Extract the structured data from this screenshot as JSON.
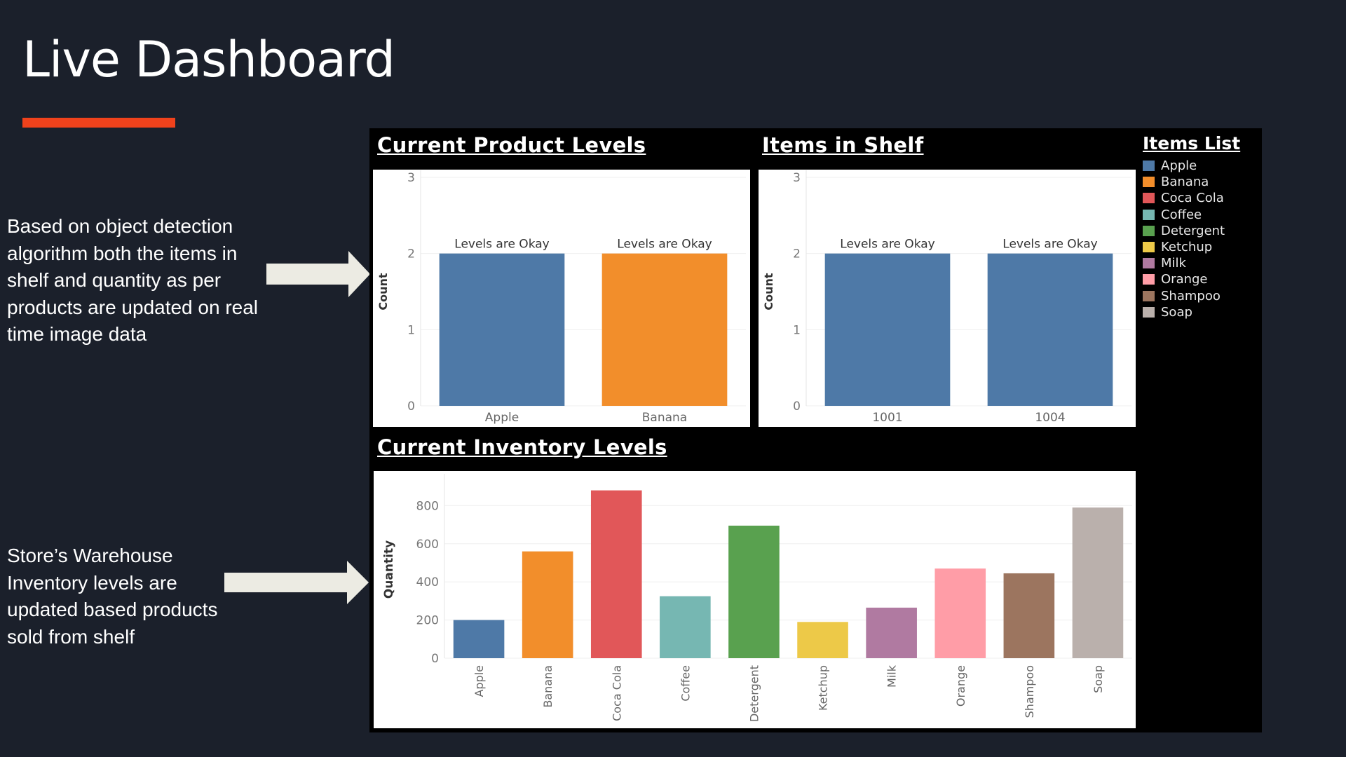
{
  "page": {
    "title": "Live Dashboard",
    "accent_color": "#f0421c",
    "background": "#1b202b"
  },
  "notes": [
    "Based on object detection algorithm both the items in shelf and quantity as per products are updated on real time image data",
    "Store’s Warehouse Inventory levels are updated based products sold from shelf"
  ],
  "legend": {
    "title": "Items List",
    "items": [
      {
        "label": "Apple",
        "color": "#4e79a7"
      },
      {
        "label": "Banana",
        "color": "#f28e2b"
      },
      {
        "label": "Coca Cola",
        "color": "#e15759"
      },
      {
        "label": "Coffee",
        "color": "#76b7b2"
      },
      {
        "label": "Detergent",
        "color": "#59a14f"
      },
      {
        "label": "Ketchup",
        "color": "#edc948"
      },
      {
        "label": "Milk",
        "color": "#b07aa1"
      },
      {
        "label": "Orange",
        "color": "#ff9da7"
      },
      {
        "label": "Shampoo",
        "color": "#9c755f"
      },
      {
        "label": "Soap",
        "color": "#bab0ac"
      }
    ]
  },
  "chart_data": [
    {
      "type": "bar",
      "title": "Current Product Levels",
      "categories": [
        "Apple",
        "Banana"
      ],
      "values": [
        2,
        2
      ],
      "colors": [
        "#4e79a7",
        "#f28e2b"
      ],
      "data_labels": [
        "Levels are Okay",
        "Levels are Okay"
      ],
      "ylabel": "Count",
      "yticks": [
        "0",
        "1",
        "2",
        "3"
      ],
      "ylim": [
        0,
        3
      ]
    },
    {
      "type": "bar",
      "title": "Items in Shelf",
      "categories": [
        "1001",
        "1004"
      ],
      "values": [
        2,
        2
      ],
      "colors": [
        "#4e79a7",
        "#4e79a7"
      ],
      "data_labels": [
        "Levels are Okay",
        "Levels are Okay"
      ],
      "ylabel": "Count",
      "yticks": [
        "0",
        "1",
        "2",
        "3"
      ],
      "ylim": [
        0,
        3
      ]
    },
    {
      "type": "bar",
      "title": "Current Inventory Levels",
      "categories": [
        "Apple",
        "Banana",
        "Coca Cola",
        "Coffee",
        "Detergent",
        "Ketchup",
        "Milk",
        "Orange",
        "Shampoo",
        "Soap"
      ],
      "values": [
        200,
        560,
        880,
        325,
        695,
        190,
        265,
        470,
        445,
        790
      ],
      "colors": [
        "#4e79a7",
        "#f28e2b",
        "#e15759",
        "#76b7b2",
        "#59a14f",
        "#edc948",
        "#b07aa1",
        "#ff9da7",
        "#9c755f",
        "#bab0ac"
      ],
      "ylabel": "Quantity",
      "yticks": [
        "0",
        "200",
        "400",
        "600",
        "800"
      ],
      "ylim": [
        0,
        930
      ]
    }
  ]
}
